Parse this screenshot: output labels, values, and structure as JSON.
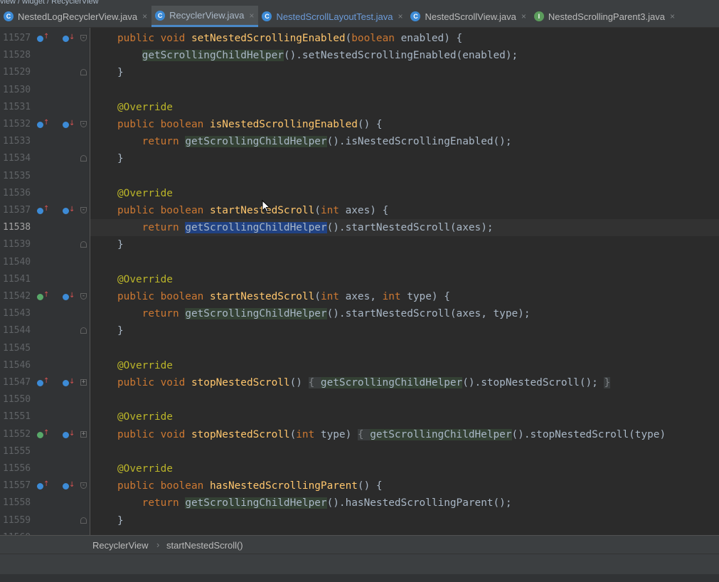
{
  "top_breadcrumb": "view / widget / RecyclerView",
  "tabs": [
    {
      "label": "NestedLogRecyclerView.java",
      "active": false,
      "blue": false,
      "icon": "C",
      "color": "blue",
      "lock": false
    },
    {
      "label": "RecyclerView.java",
      "active": true,
      "blue": false,
      "icon": "C",
      "color": "blue",
      "lock": true
    },
    {
      "label": "NestedScrollLayoutTest.java",
      "active": false,
      "blue": true,
      "icon": "C",
      "color": "blue",
      "lock": false
    },
    {
      "label": "NestedScrollView.java",
      "active": false,
      "blue": false,
      "icon": "C",
      "color": "blue",
      "lock": true
    },
    {
      "label": "NestedScrollingParent3.java",
      "active": false,
      "blue": false,
      "icon": "I",
      "color": "green",
      "lock": true
    }
  ],
  "tab_close_glyph": "×",
  "lines": [
    {
      "num": "11527",
      "g1": "blue",
      "g2": true,
      "fold": "open",
      "code": [
        [
          "kw",
          "public void "
        ],
        [
          "fn",
          "setNestedScrollingEnabled"
        ],
        [
          "",
          "("
        ],
        [
          "kw",
          "boolean "
        ],
        [
          "",
          "enabled) {"
        ]
      ]
    },
    {
      "num": "11528",
      "code": [
        [
          "",
          "    "
        ],
        [
          "call",
          "getScrollingChildHelper"
        ],
        [
          "",
          "().setNestedScrollingEnabled(enabled);"
        ]
      ]
    },
    {
      "num": "11529",
      "fold": "close",
      "code": [
        [
          "",
          "}"
        ]
      ]
    },
    {
      "num": "11530",
      "code": []
    },
    {
      "num": "11531",
      "code": [
        [
          "ann",
          "@Override"
        ]
      ]
    },
    {
      "num": "11532",
      "g1": "blue",
      "g2": true,
      "fold": "open",
      "code": [
        [
          "kw",
          "public boolean "
        ],
        [
          "fn",
          "isNestedScrollingEnabled"
        ],
        [
          "",
          "() {"
        ]
      ]
    },
    {
      "num": "11533",
      "code": [
        [
          "",
          "    "
        ],
        [
          "kw",
          "return "
        ],
        [
          "call",
          "getScrollingChildHelper"
        ],
        [
          "",
          "().isNestedScrollingEnabled();"
        ]
      ]
    },
    {
      "num": "11534",
      "fold": "close",
      "code": [
        [
          "",
          "}"
        ]
      ]
    },
    {
      "num": "11535",
      "code": []
    },
    {
      "num": "11536",
      "code": [
        [
          "ann",
          "@Override"
        ]
      ]
    },
    {
      "num": "11537",
      "g1": "blue",
      "g2": true,
      "fold": "open",
      "code": [
        [
          "kw",
          "public boolean "
        ],
        [
          "fn",
          "startNestedScroll"
        ],
        [
          "",
          "("
        ],
        [
          "kw",
          "int "
        ],
        [
          "",
          "axes) {"
        ]
      ]
    },
    {
      "num": "11538",
      "current": true,
      "code": [
        [
          "",
          "    "
        ],
        [
          "kw",
          "return "
        ],
        [
          "sel",
          "getScrollingChildHelper"
        ],
        [
          "",
          "().startNestedScroll(axes);"
        ]
      ]
    },
    {
      "num": "11539",
      "fold": "close",
      "code": [
        [
          "",
          "}"
        ]
      ]
    },
    {
      "num": "11540",
      "code": []
    },
    {
      "num": "11541",
      "code": [
        [
          "ann",
          "@Override"
        ]
      ]
    },
    {
      "num": "11542",
      "g1": "green",
      "g2": true,
      "fold": "open",
      "code": [
        [
          "kw",
          "public boolean "
        ],
        [
          "fn",
          "startNestedScroll"
        ],
        [
          "",
          "("
        ],
        [
          "kw",
          "int "
        ],
        [
          "",
          "axes, "
        ],
        [
          "kw",
          "int "
        ],
        [
          "",
          "type) {"
        ]
      ]
    },
    {
      "num": "11543",
      "code": [
        [
          "",
          "    "
        ],
        [
          "kw",
          "return "
        ],
        [
          "call",
          "getScrollingChildHelper"
        ],
        [
          "",
          "().startNestedScroll(axes, type);"
        ]
      ]
    },
    {
      "num": "11544",
      "fold": "close",
      "code": [
        [
          "",
          "}"
        ]
      ]
    },
    {
      "num": "11545",
      "code": []
    },
    {
      "num": "11546",
      "code": [
        [
          "ann",
          "@Override"
        ]
      ]
    },
    {
      "num": "11547",
      "g1": "blue",
      "g2": true,
      "fold": "plus",
      "code": [
        [
          "kw",
          "public void "
        ],
        [
          "fn",
          "stopNestedScroll"
        ],
        [
          "",
          "() "
        ],
        [
          "fbox",
          "{ "
        ],
        [
          "call",
          "getScrollingChildHelper"
        ],
        [
          "",
          "().stopNestedScroll(); "
        ],
        [
          "fbox",
          "}"
        ]
      ]
    },
    {
      "num": "11550",
      "code": []
    },
    {
      "num": "11551",
      "code": [
        [
          "ann",
          "@Override"
        ]
      ]
    },
    {
      "num": "11552",
      "g1": "green",
      "g2": true,
      "fold": "plus",
      "code": [
        [
          "kw",
          "public void "
        ],
        [
          "fn",
          "stopNestedScroll"
        ],
        [
          "",
          "("
        ],
        [
          "kw",
          "int "
        ],
        [
          "",
          "type) "
        ],
        [
          "fbox",
          "{ "
        ],
        [
          "call",
          "getScrollingChildHelper"
        ],
        [
          "",
          "().stopNestedScroll(type)"
        ]
      ]
    },
    {
      "num": "11555",
      "code": []
    },
    {
      "num": "11556",
      "code": [
        [
          "ann",
          "@Override"
        ]
      ]
    },
    {
      "num": "11557",
      "g1": "blue",
      "g2": true,
      "fold": "open",
      "code": [
        [
          "kw",
          "public boolean "
        ],
        [
          "fn",
          "hasNestedScrollingParent"
        ],
        [
          "",
          "() {"
        ]
      ]
    },
    {
      "num": "11558",
      "code": [
        [
          "",
          "    "
        ],
        [
          "kw",
          "return "
        ],
        [
          "call",
          "getScrollingChildHelper"
        ],
        [
          "",
          "().hasNestedScrollingParent();"
        ]
      ]
    },
    {
      "num": "11559",
      "fold": "close",
      "code": [
        [
          "",
          "}"
        ]
      ]
    },
    {
      "num": "11560",
      "code": []
    }
  ],
  "breadcrumb": {
    "class_name": "RecyclerView",
    "separator": "›",
    "method": "startNestedScroll()"
  }
}
